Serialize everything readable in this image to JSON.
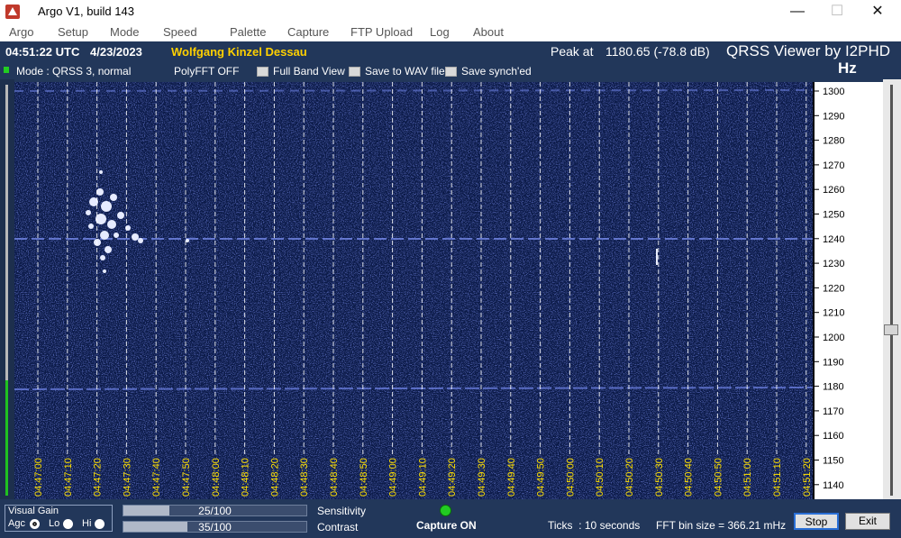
{
  "window": {
    "title": "Argo V1, build 143",
    "minimize": "—",
    "maximize": "☐",
    "close": "✕"
  },
  "menu": [
    "Argo",
    "Setup",
    "Mode",
    "Speed",
    "Palette",
    "Capture",
    "FTP Upload",
    "Log",
    "About"
  ],
  "info": {
    "time": "04:51:22 UTC",
    "date": "4/23/2023",
    "operator": "Wolfgang Kinzel Dessau",
    "peak_label": "Peak at",
    "peak_value": "1180.65 (-78.8 dB)",
    "brand": "QRSS Viewer by I2PHD",
    "unit": "Hz",
    "mode": "Mode : QRSS 3, normal",
    "polyfft": "PolyFFT OFF",
    "full_band": "Full Band View",
    "save_wav": "Save to WAV file",
    "save_synched": "Save synch'ed"
  },
  "time_ticks": [
    "04:47:00",
    "04:47:10",
    "04:47:20",
    "04:47:30",
    "04:47:40",
    "04:47:50",
    "04:48:00",
    "04:48:10",
    "04:48:20",
    "04:48:30",
    "04:48:40",
    "04:48:50",
    "04:49:00",
    "04:49:10",
    "04:49:20",
    "04:49:30",
    "04:49:40",
    "04:49:50",
    "04:50:00",
    "04:50:10",
    "04:50:20",
    "04:50:30",
    "04:50:40",
    "04:50:50",
    "04:51:00",
    "04:51:10",
    "04:51:20"
  ],
  "freq_ticks": [
    "1300",
    "1290",
    "1280",
    "1270",
    "1260",
    "1250",
    "1240",
    "1230",
    "1220",
    "1210",
    "1200",
    "1190",
    "1180",
    "1170",
    "1160",
    "1150",
    "1140"
  ],
  "controls": {
    "visual_gain": "Visual Gain",
    "agc": "Agc",
    "lo": "Lo",
    "hi": "Hi",
    "sensitivity_value": "25/100",
    "sensitivity_level": 0.25,
    "sensitivity_label": "Sensitivity",
    "contrast_value": "35/100",
    "contrast_level": 0.35,
    "contrast_label": "Contrast",
    "capture_status": "Capture ON",
    "ticks": "Ticks  : 10 seconds",
    "fft_bin": "FFT bin size = 366.21 mHz",
    "stop": "Stop",
    "exit": "Exit"
  },
  "colors": {
    "background": "#22375a",
    "waterfall": "#0b1a48",
    "signal": "#8fa3ff",
    "operator": "#ffd000",
    "tick_label": "#ffe000",
    "indicator": "#22cc22"
  }
}
